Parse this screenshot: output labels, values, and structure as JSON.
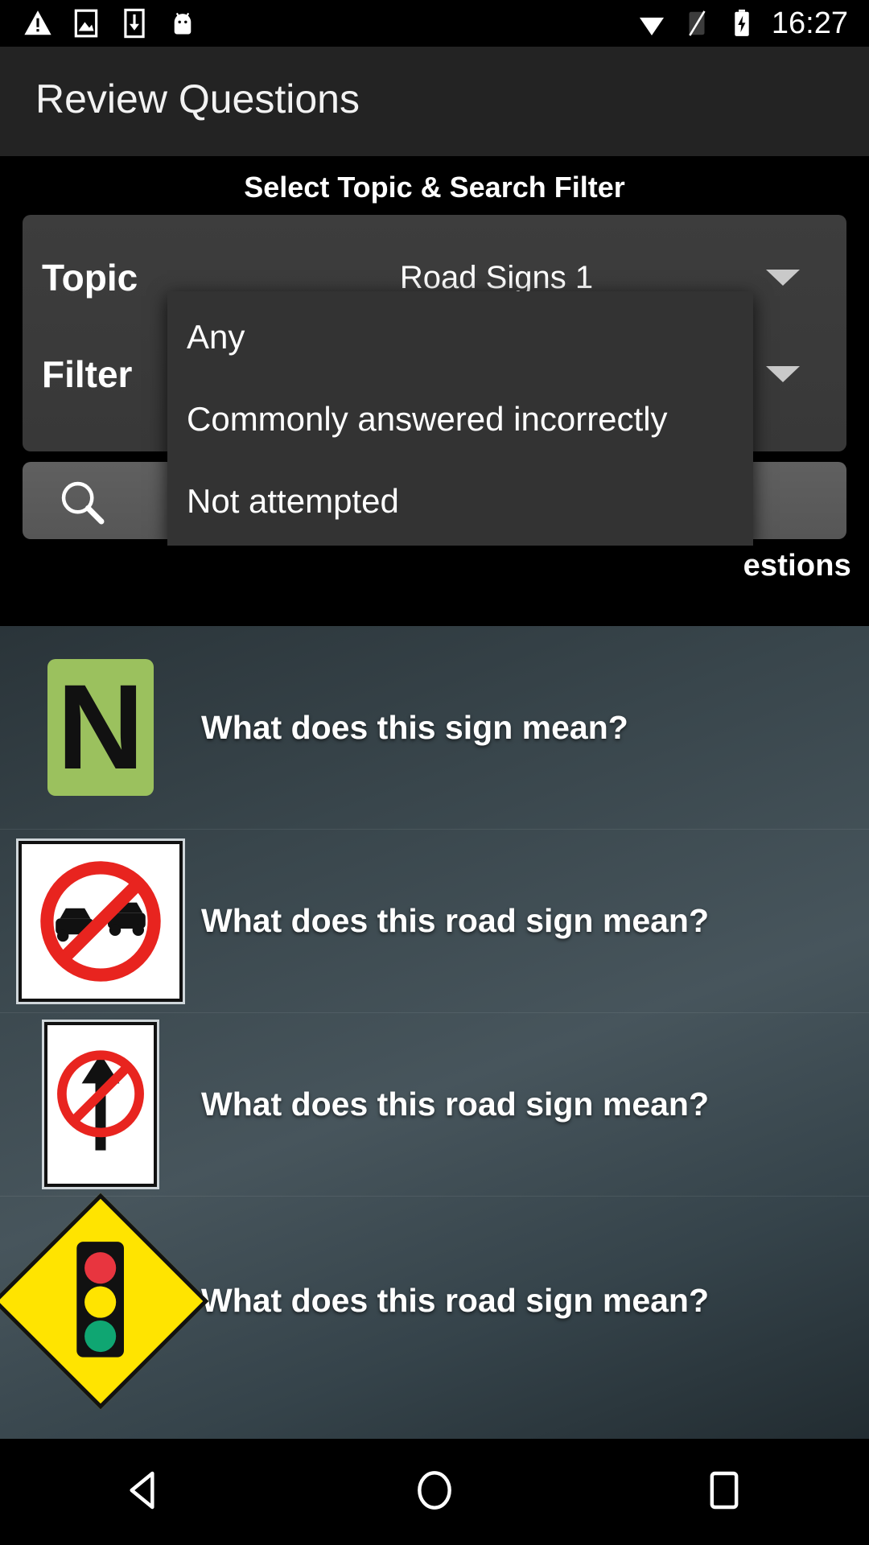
{
  "status_bar": {
    "icons_left": [
      "warning-triangle-icon",
      "image-icon",
      "download-icon",
      "android-bugdroid-icon"
    ],
    "icons_right": [
      "wifi-icon",
      "sim-off-icon",
      "battery-charging-icon"
    ],
    "time": "16:27"
  },
  "action_bar": {
    "title": "Review Questions"
  },
  "filter_panel": {
    "heading": "Select Topic & Search Filter",
    "topic": {
      "label": "Topic",
      "value": "Road Signs 1",
      "caret": "chevron-down-icon"
    },
    "filter": {
      "label": "Filter",
      "value": "Any",
      "caret": "chevron-down-icon"
    },
    "search": {
      "icon": "search-icon",
      "value": "",
      "placeholder": ""
    },
    "count_label": "estions"
  },
  "dropdown": {
    "open": true,
    "options": [
      "Any",
      "Commonly answered incorrectly",
      "Not attempted"
    ],
    "selected": "Any"
  },
  "questions": [
    {
      "thumb": "green-n-sign",
      "text": "What does this sign mean?"
    },
    {
      "thumb": "no-overtaking-sign",
      "text": "What does this road sign mean?"
    },
    {
      "thumb": "no-straight-ahead-sign",
      "text": "What does this road sign mean?"
    },
    {
      "thumb": "traffic-signals-ahead-sign",
      "text": "What does this road sign mean?"
    }
  ],
  "nav_bar": {
    "back": "back-triangle-icon",
    "home": "home-circle-icon",
    "recents": "recents-square-icon"
  },
  "colors": {
    "status_bg": "#000000",
    "action_bar_bg": "#232323",
    "panel_bg": "#000000",
    "card_bg": "#3a3a3a",
    "search_bg": "#5a5a5a",
    "popup_bg": "#333333",
    "text": "#ffffff",
    "sign_green": "#9bc15e",
    "sign_yellow": "#ffe400",
    "sign_red": "#e8241f"
  }
}
